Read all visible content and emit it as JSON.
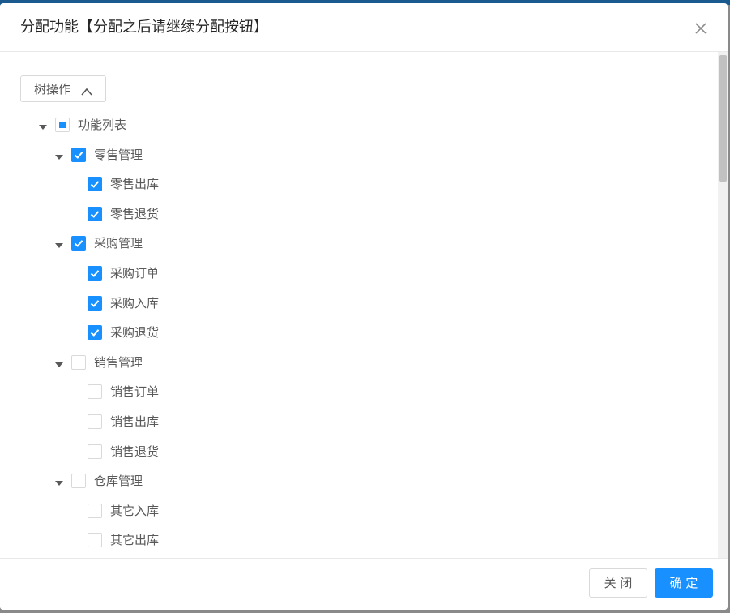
{
  "dialog": {
    "title": "分配功能【分配之后请继续分配按钮】",
    "close_icon": "close-icon"
  },
  "toolbar": {
    "tree_op_label": "树操作",
    "tree_op_icon": "chevron-up-icon"
  },
  "tree": {
    "root": {
      "label": "功能列表",
      "state": "indeterminate",
      "expanded": true
    },
    "groups": [
      {
        "label": "零售管理",
        "state": "checked",
        "expanded": true,
        "children": [
          {
            "label": "零售出库",
            "state": "checked"
          },
          {
            "label": "零售退货",
            "state": "checked"
          }
        ]
      },
      {
        "label": "采购管理",
        "state": "checked",
        "expanded": true,
        "children": [
          {
            "label": "采购订单",
            "state": "checked"
          },
          {
            "label": "采购入库",
            "state": "checked"
          },
          {
            "label": "采购退货",
            "state": "checked"
          }
        ]
      },
      {
        "label": "销售管理",
        "state": "unchecked",
        "expanded": true,
        "children": [
          {
            "label": "销售订单",
            "state": "unchecked"
          },
          {
            "label": "销售出库",
            "state": "unchecked"
          },
          {
            "label": "销售退货",
            "state": "unchecked"
          }
        ]
      },
      {
        "label": "仓库管理",
        "state": "unchecked",
        "expanded": true,
        "children": [
          {
            "label": "其它入库",
            "state": "unchecked"
          },
          {
            "label": "其它出库",
            "state": "unchecked"
          }
        ]
      }
    ]
  },
  "footer": {
    "close_label": "关 闭",
    "ok_label": "确 定"
  },
  "colors": {
    "primary": "#1890ff",
    "border": "#d9d9d9",
    "text": "#595959"
  }
}
